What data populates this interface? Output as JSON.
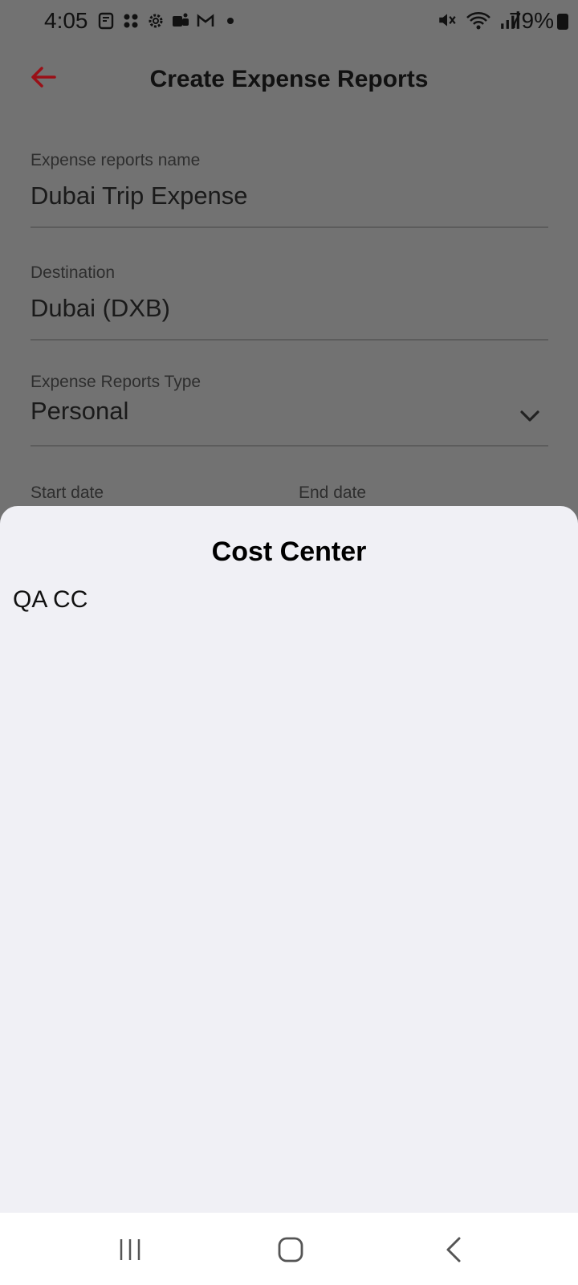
{
  "status_bar": {
    "time": "4:05",
    "battery": "79%"
  },
  "header": {
    "title": "Create Expense Reports",
    "back_icon": "arrow-left-icon",
    "accent_color": "#b3141e"
  },
  "form": {
    "name": {
      "label": "Expense reports name",
      "value": "Dubai Trip Expense"
    },
    "destination": {
      "label": "Destination",
      "value": "Dubai (DXB)"
    },
    "type": {
      "label": "Expense Reports Type",
      "value": "Personal"
    },
    "start_date": {
      "label": "Start date"
    },
    "end_date": {
      "label": "End date"
    }
  },
  "sheet": {
    "title": "Cost Center",
    "items": [
      {
        "label": "QA CC"
      }
    ]
  },
  "nav": {
    "recent_icon": "recent-apps-icon",
    "home_icon": "home-icon",
    "back_icon": "back-icon"
  }
}
